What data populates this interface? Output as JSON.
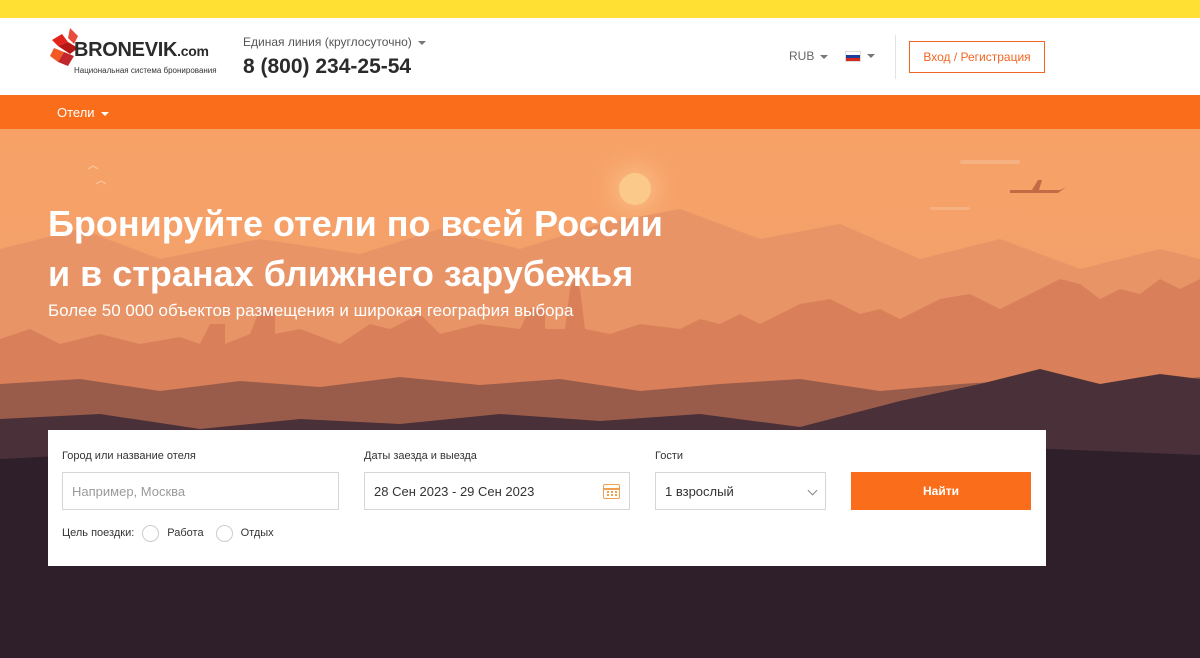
{
  "header": {
    "logo_name": "BRONEVIK",
    "logo_domain": ".com",
    "logo_tagline": "Национальная система бронирования",
    "hotline_label": "Единая линия (круглосуточно)",
    "phone": "8 (800) 234-25-54",
    "currency": "RUB",
    "language_icon": "russia-flag-icon",
    "login_label": "Вход / Регистрация"
  },
  "nav": {
    "items": [
      {
        "label": "Отели"
      }
    ]
  },
  "hero": {
    "title_line1": "Бронируйте отели по всей России",
    "title_line2": "и в странах ближнего зарубежья",
    "subtitle": "Более 50 000 объектов размещения и широкая география выбора"
  },
  "search": {
    "city_label": "Город или название отеля",
    "city_placeholder": "Например, Москва",
    "dates_label": "Даты заезда и выезда",
    "dates_value": "28 Сен 2023 - 29 Сен 2023",
    "guests_label": "Гости",
    "guests_value": "1 взрослый",
    "submit_label": "Найти",
    "purpose_label": "Цель поездки:",
    "purpose_options": [
      {
        "label": "Работа"
      },
      {
        "label": "Отдых"
      }
    ]
  },
  "colors": {
    "accent": "#fa6d1a",
    "topbar": "#ffe033",
    "login_border": "#f26522"
  }
}
